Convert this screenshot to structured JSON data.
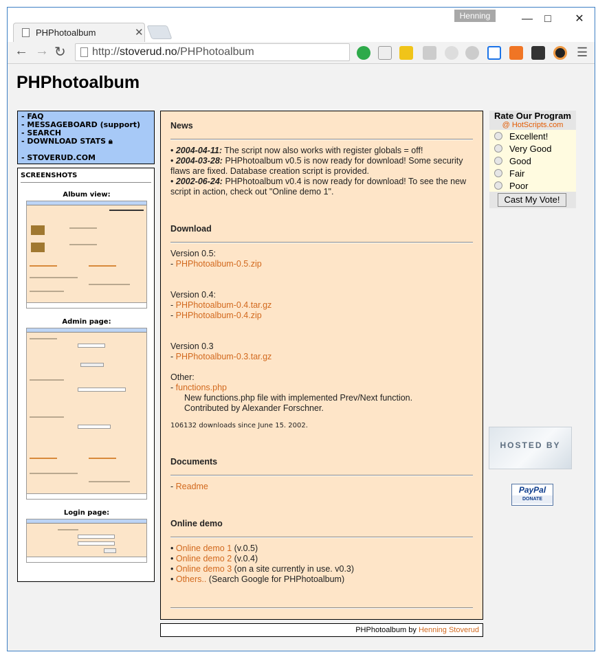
{
  "browser": {
    "user": "Henning",
    "tab_title": "PHPhotoalbum",
    "url_prefix": "http://",
    "url_host": "stoverud.no",
    "url_path": "/PHPhotoalbum"
  },
  "site": {
    "title": "PHPhotoalbum"
  },
  "nav": {
    "items": [
      "- FAQ",
      "- MESSAGEBOARD (support)",
      "- SEARCH",
      "- DOWNLOAD STATS",
      "- STOVERUD.COM"
    ],
    "lock_icon": "lock-icon"
  },
  "screenshots": {
    "heading": "SCREENSHOTS",
    "album_label": "Album view:",
    "admin_label": "Admin page:",
    "login_label": "Login page:"
  },
  "news": {
    "title": "News",
    "items": [
      {
        "date": "2004-04-11:",
        "text": " The script now also works with register globals = off!"
      },
      {
        "date": "2004-03-28:",
        "text": " PHPhotoalbum v0.5 is now ready for download! Some security flaws are fixed. Database creation script is provided."
      },
      {
        "date": "2002-06-24:",
        "text": " PHPhotoalbum v0.4 is now ready for download! To see the new script in action, check out \"Online demo 1\"."
      }
    ]
  },
  "download": {
    "title": "Download",
    "v05_label": "Version 0.5:",
    "v05_link": "PHPhotoalbum-0.5.zip",
    "v04_label": "Version 0.4:",
    "v04_link1": "PHPhotoalbum-0.4.tar.gz",
    "v04_link2": "PHPhotoalbum-0.4.zip",
    "v03_label": "Version 0.3",
    "v03_link": "PHPhotoalbum-0.3.tar.gz",
    "other_label": "Other:",
    "other_link": "functions.php",
    "other_desc1": "New functions.php file with implemented Prev/Next function.",
    "other_desc2": "Contributed by Alexander Forschner.",
    "stats": "106132 downloads since June 15. 2002."
  },
  "documents": {
    "title": "Documents",
    "link": "Readme"
  },
  "demo": {
    "title": "Online demo",
    "items": [
      {
        "link": "Online demo 1",
        "note": " (v.0.5)"
      },
      {
        "link": "Online demo 2",
        "note": " (v.0.4)"
      },
      {
        "link": "Online demo 3",
        "note": " (on a site currently in use. v0.3)"
      },
      {
        "link": "Others..",
        "note": " (Search Google for PHPhotoalbum)"
      }
    ]
  },
  "footer": {
    "prefix": "PHPhotoalbum by ",
    "author": "Henning Stoverud"
  },
  "vote": {
    "title": "Rate Our Program",
    "subtitle": "@ HotScripts.com",
    "options": [
      "Excellent!",
      "Very Good",
      "Good",
      "Fair",
      "Poor"
    ],
    "button": "Cast My Vote!"
  },
  "badges": {
    "hosted": "HOSTED BY",
    "paypal_logo": "PayPal",
    "paypal_donate": "DONATE"
  }
}
